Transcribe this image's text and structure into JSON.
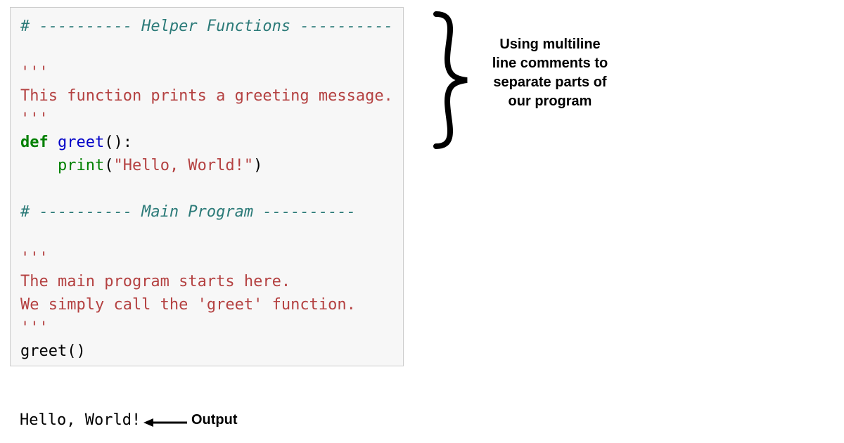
{
  "code": {
    "line01_comment": "# ---------- Helper Functions ----------",
    "line02_blank": "",
    "line03_doc_open": "'''",
    "line04_doc_text": "This function prints a greeting message.",
    "line05_doc_close": "'''",
    "line06_def_kw": "def",
    "line06_fn_name": "greet",
    "line06_def_tail": "():",
    "line07_indent": "    ",
    "line07_print": "print",
    "line07_paren_open": "(",
    "line07_string": "\"Hello, World!\"",
    "line07_paren_close": ")",
    "line08_blank": "",
    "line09_comment": "# ---------- Main Program ----------",
    "line10_blank": "",
    "line11_doc_open": "'''",
    "line12_doc_text1": "The main program starts here.",
    "line13_doc_text2": "We simply call the 'greet' function.",
    "line14_doc_close": "'''",
    "line15_call": "greet()"
  },
  "output_text": "Hello, World!",
  "output_label": "Output",
  "annotation_text": "Using multiline line comments to separate parts of our program"
}
